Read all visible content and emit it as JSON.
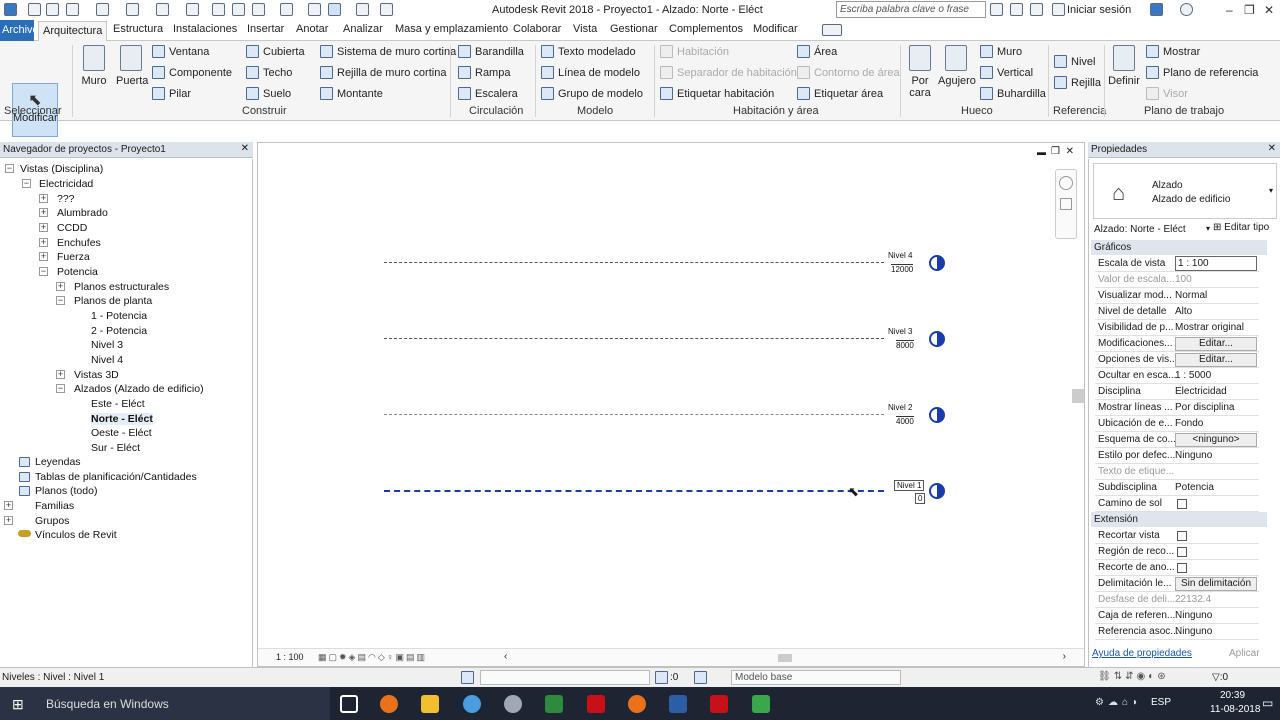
{
  "app": {
    "title": "Autodesk Revit 2018 -    Proyecto1 - Alzado: Norte - Eléct",
    "search_placeholder": "Escriba palabra clave o frase",
    "user": "Iniciar sesión"
  },
  "tabs": [
    "Archivo",
    "Arquitectura",
    "Estructura",
    "Instalaciones",
    "Insertar",
    "Anotar",
    "Analizar",
    "Masa y emplazamiento",
    "Colaborar",
    "Vista",
    "Gestionar",
    "Complementos",
    "Modificar"
  ],
  "ribbon": {
    "modificar": "Modificar",
    "seleccionar": "Seleccionar",
    "muro": "Muro",
    "puerta": "Puerta",
    "ventana": "Ventana",
    "componente": "Componente",
    "pilar": "Pilar",
    "cubierta": "Cubierta",
    "techo": "Techo",
    "suelo": "Suelo",
    "sistema_muro": "Sistema de muro cortina",
    "rejilla_muro": "Rejilla de muro cortina",
    "montante": "Montante",
    "construir": "Construir",
    "barandilla": "Barandilla",
    "rampa": "Rampa",
    "escalera": "Escalera",
    "circulacion": "Circulación",
    "texto_modelado": "Texto modelado",
    "linea_modelo": "Línea de modelo",
    "grupo_modelo": "Grupo de modelo",
    "modelo": "Modelo",
    "habitacion": "Habitación",
    "separador": "Separador de habitación",
    "etiquetar_hab": "Etiquetar  habitación",
    "area": "Área",
    "contorno_area": "Contorno  de área",
    "etiquetar_area": "Etiquetar  área",
    "hab_area": "Habitación y área",
    "por_cara": "Por cara",
    "agujero": "Agujero",
    "muro_h": "Muro",
    "vertical": "Vertical",
    "buhardilla": "Buhardilla",
    "hueco": "Hueco",
    "nivel": "Nivel",
    "rejilla": "Rejilla",
    "referencia": "Referencia",
    "definir": "Definir",
    "mostrar": "Mostrar",
    "plano_ref": "Plano de referencia",
    "visor": "Visor",
    "plano_trabajo": "Plano de trabajo"
  },
  "browser": {
    "title": "Navegador de proyectos - Proyecto1",
    "nodes": [
      "Vistas (Disciplina)",
      "Electricidad",
      "???",
      "Alumbrado",
      "CCDD",
      "Enchufes",
      "Fuerza",
      "Potencia",
      "Planos estructurales",
      "Planos de planta",
      "1 - Potencia",
      "2 - Potencia",
      "Nivel 3",
      "Nivel 4",
      "Vistas 3D",
      "Alzados (Alzado de edificio)",
      "Este - Eléct",
      "Norte - Eléct",
      "Oeste - Eléct",
      "Sur - Eléct",
      "Leyendas",
      "Tablas de planificación/Cantidades",
      "Planos (todo)",
      "Familias",
      "Grupos",
      "Vínculos de Revit"
    ]
  },
  "levels": [
    {
      "name": "Nivel 4",
      "elev": "12000"
    },
    {
      "name": "Nivel 3",
      "elev": "8000"
    },
    {
      "name": "Nivel 2",
      "elev": "4000"
    },
    {
      "name": "Nivel 1",
      "elev": "0"
    }
  ],
  "props": {
    "title": "Propiedades",
    "type1": "Alzado",
    "type2": "Alzado de edificio",
    "selector": "Alzado: Norte - Eléct",
    "edit_type": "Editar tipo",
    "sec_graficos": "Gráficos",
    "sec_extension": "Extensión",
    "rows": [
      [
        "Escala de vista",
        "1 : 100"
      ],
      [
        "Valor de escala...",
        "100"
      ],
      [
        "Visualizar mod...",
        "Normal"
      ],
      [
        "Nivel de detalle",
        "Alto"
      ],
      [
        "Visibilidad de p...",
        "Mostrar original"
      ],
      [
        "Modificaciones...",
        "Editar..."
      ],
      [
        "Opciones de vis...",
        "Editar..."
      ],
      [
        "Ocultar en esca...",
        "1 : 5000"
      ],
      [
        "Disciplina",
        "Electricidad"
      ],
      [
        "Mostrar líneas ...",
        "Por disciplina"
      ],
      [
        "Ubicación de e...",
        "Fondo"
      ],
      [
        "Esquema de co...",
        "<ninguno>"
      ],
      [
        "Estilo por defec...",
        "Ninguno"
      ],
      [
        "Texto de etique...",
        ""
      ],
      [
        "Subdisciplina",
        "Potencia"
      ],
      [
        "Camino de sol",
        ""
      ]
    ],
    "rows2": [
      [
        "Recortar vista",
        ""
      ],
      [
        "Región de reco...",
        ""
      ],
      [
        "Recorte de ano...",
        ""
      ],
      [
        "Delimitación le...",
        "Sin delimitación"
      ],
      [
        "Desfase de deli...",
        "22132.4"
      ],
      [
        "Caja de referen...",
        "Ninguno"
      ],
      [
        "Referencia asoc...",
        "Ninguno"
      ]
    ],
    "help": "Ayuda de propiedades",
    "apply": "Aplicar"
  },
  "status": {
    "text": "Niveles : Nivel : Nivel 1",
    "scale": "1 : 100",
    "zero": ":0",
    "model": "Modelo base"
  },
  "taskbar": {
    "search": "Búsqueda en Windows",
    "lang": "ESP",
    "time": "20:39",
    "date": "11-08-2018"
  }
}
